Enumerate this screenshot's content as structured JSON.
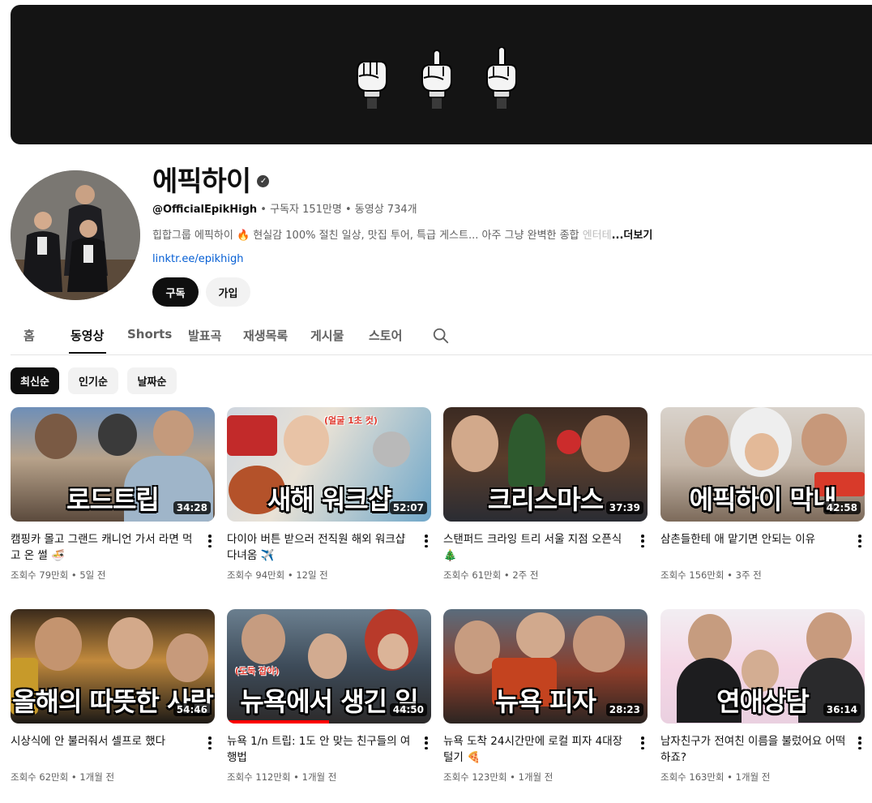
{
  "channel": {
    "name": "에픽하이",
    "handle": "@OfficialEpikHigh",
    "subscribers": "구독자 151만명",
    "video_count": "동영상 734개",
    "sep": "•",
    "description": "힙합그룹 에픽하이 🔥 현실감 100% 절친 일상, 맛집 투어, 특급 게스트... 아주 그냥 완벽한 종합 ",
    "description_fade": "엔터테",
    "more_label": "...더보기",
    "link": "linktr.ee/epikhigh",
    "subscribe_label": "구독",
    "join_label": "가입"
  },
  "tabs": [
    {
      "label": "홈"
    },
    {
      "label": "동영상"
    },
    {
      "label": "Shorts"
    },
    {
      "label": "발표곡"
    },
    {
      "label": "재생목록"
    },
    {
      "label": "게시물"
    },
    {
      "label": "스토어"
    }
  ],
  "active_tab": "동영상",
  "chips": [
    {
      "label": "최신순"
    },
    {
      "label": "인기순"
    },
    {
      "label": "날짜순"
    }
  ],
  "videos": [
    {
      "thumb_text": "로드트립",
      "duration": "34:28",
      "title": "캠핑카 몰고 그랜드 캐니언 가서 라면 먹고 온 썰 🍜",
      "views": "조회수 79만회",
      "age": "5일 전"
    },
    {
      "thumb_text": "새해 워크샵",
      "thumb_sub": "(얼굴 1초 컷)",
      "duration": "52:07",
      "title": "다이아 버튼 받으러 전직원 해외 워크샵 다녀옴 ✈️",
      "views": "조회수 94만회",
      "age": "12일 전"
    },
    {
      "thumb_text": "크리스마스",
      "duration": "37:39",
      "title": "스탠퍼드 크라잉 트리 서울 지점 오픈식 🎄",
      "views": "조회수 61만회",
      "age": "2주 전"
    },
    {
      "thumb_text": "에픽하이 막내",
      "duration": "42:58",
      "title": "삼촌들한테 애 맡기면 안되는 이유",
      "views": "조회수 156만회",
      "age": "3주 전"
    },
    {
      "thumb_text": "올해의 따뜻한 사람",
      "duration": "54:46",
      "title": "시상식에 안 불러줘서 셀프로 했다",
      "views": "조회수 62만회",
      "age": "1개월 전"
    },
    {
      "thumb_text": "뉴욕에서 생긴 일",
      "thumb_sub": "(도둑 잡아)",
      "duration": "44:50",
      "title": "뉴욕 1/n 트립: 1도 안 맞는 친구들의 여행법",
      "views": "조회수 112만회",
      "age": "1개월 전",
      "watched": 0.5
    },
    {
      "thumb_text": "뉴욕 피자",
      "duration": "28:23",
      "title": "뉴욕 도착 24시간만에 로컬 피자 4대장 털기 🍕",
      "views": "조회수 123만회",
      "age": "1개월 전"
    },
    {
      "thumb_text": "연애상담",
      "duration": "36:14",
      "title": "남자친구가 전여친 이름을 불렀어요 어떡하죠?",
      "views": "조회수 163만회",
      "age": "1개월 전"
    }
  ],
  "icons": {
    "verified": "verified-check-icon",
    "search": "search-icon",
    "more": "more-vert-icon",
    "banner": "hand-gesture-icon"
  },
  "colors": {
    "link": "#065fd4",
    "progress": "#ff0000",
    "subscribe_bg": "#0f0f0f"
  }
}
